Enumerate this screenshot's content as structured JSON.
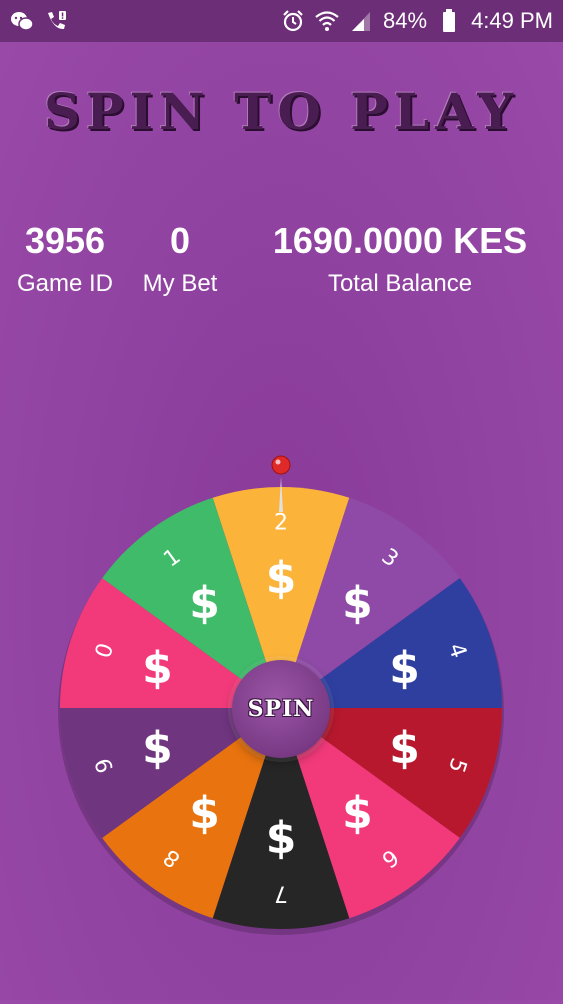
{
  "status_bar": {
    "battery_text": "84%",
    "time": "4:49 PM",
    "icons": [
      "wechat-icon",
      "phone-alert-icon",
      "alarm-icon",
      "wifi-icon",
      "signal-icon",
      "battery-icon"
    ]
  },
  "title": "SPIN TO PLAY",
  "stats": [
    {
      "value": "3956",
      "label": "Game ID"
    },
    {
      "value": "0",
      "label": "My Bet"
    },
    {
      "value": "1690.0000 KES",
      "label": "Total Balance"
    }
  ],
  "wheel": {
    "spin_label": "SPIN",
    "pointer_icon": "pin-icon",
    "segments": [
      {
        "number": "2",
        "symbol": "$",
        "color": "#fbb33a"
      },
      {
        "number": "3",
        "symbol": "$",
        "color": "#8e4aa6"
      },
      {
        "number": "4",
        "symbol": "$",
        "color": "#2f3fa0"
      },
      {
        "number": "5",
        "symbol": "$",
        "color": "#b8182e"
      },
      {
        "number": "6",
        "symbol": "$",
        "color": "#f23a7a"
      },
      {
        "number": "7",
        "symbol": "$",
        "color": "#262626"
      },
      {
        "number": "8",
        "symbol": "$",
        "color": "#e8730f"
      },
      {
        "number": "9",
        "symbol": "$",
        "color": "#6f357f"
      },
      {
        "number": "0",
        "symbol": "$",
        "color": "#f23a7a"
      },
      {
        "number": "1",
        "symbol": "$",
        "color": "#3fbb6a"
      }
    ]
  }
}
